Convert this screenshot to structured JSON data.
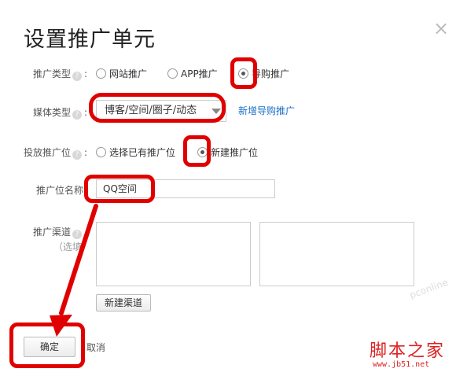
{
  "dialog": {
    "title": "设置推广单元",
    "close_icon": "close-icon"
  },
  "form": {
    "promo_type": {
      "label": "推广类型",
      "options": [
        "网站推广",
        "APP推广",
        "导购推广"
      ],
      "selected": "导购推广"
    },
    "media_type": {
      "label": "媒体类型",
      "value": "博客/空间/圈子/动态",
      "add_link": "新增导购推广"
    },
    "placement": {
      "label": "投放推广位",
      "options": [
        "选择已有推广位",
        "新建推广位"
      ],
      "selected": "新建推广位"
    },
    "placement_name": {
      "label": "推广位名称",
      "value": "QQ空间"
    },
    "channel": {
      "label": "推广渠道",
      "sub_label": "（选填）",
      "new_channel_button": "新建渠道"
    }
  },
  "actions": {
    "confirm": "确定",
    "cancel": "取消"
  },
  "watermark": {
    "brand": "脚本之家",
    "url": "www.jb51.net",
    "faint": "pconline"
  },
  "colors": {
    "highlight": "#e00000",
    "link": "#1a6fc4"
  }
}
